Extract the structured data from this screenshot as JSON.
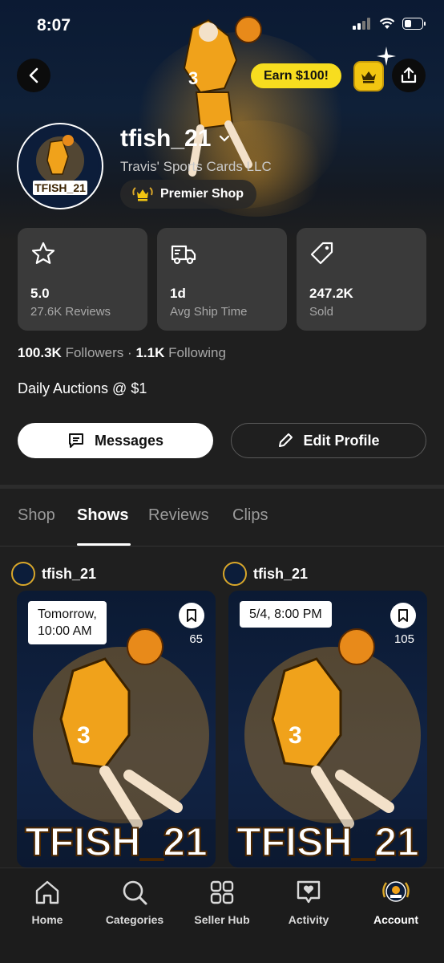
{
  "status_bar": {
    "time": "8:07"
  },
  "header": {
    "earn_label": "Earn $100!"
  },
  "profile": {
    "username": "tfish_21",
    "shop_name": "Travis' Sports Cards LLC",
    "badge_label": "Premier Shop",
    "avatar_text": "TFISH_21",
    "bio": "Daily Auctions @ $1"
  },
  "stats": [
    {
      "icon": "star-icon",
      "value": "5.0",
      "label": "27.6K Reviews"
    },
    {
      "icon": "truck-icon",
      "value": "1d",
      "label": "Avg Ship Time"
    },
    {
      "icon": "tag-icon",
      "value": "247.2K",
      "label": "Sold"
    }
  ],
  "follow": {
    "followers_count": "100.3K",
    "followers_label": "Followers",
    "separator": "·",
    "following_count": "1.1K",
    "following_label": "Following"
  },
  "actions": {
    "messages_label": "Messages",
    "edit_label": "Edit Profile"
  },
  "tabs": [
    {
      "label": "Shop",
      "active": false
    },
    {
      "label": "Shows",
      "active": true
    },
    {
      "label": "Reviews",
      "active": false
    },
    {
      "label": "Clips",
      "active": false
    }
  ],
  "shows": [
    {
      "host": "tfish_21",
      "time": "Tomorrow,\n10:00 AM",
      "time_line1": "Tomorrow,",
      "time_line2": "10:00 AM",
      "bookmarks": "65",
      "art_text": "TFISH_21"
    },
    {
      "host": "tfish_21",
      "time_line1": "5/4, 8:00 PM",
      "time_line2": "",
      "bookmarks": "105",
      "art_text": "TFISH_21"
    }
  ],
  "nav": [
    {
      "label": "Home",
      "icon": "home-icon"
    },
    {
      "label": "Categories",
      "icon": "search-icon"
    },
    {
      "label": "Seller Hub",
      "icon": "grid-icon"
    },
    {
      "label": "Activity",
      "icon": "heart-chat-icon"
    },
    {
      "label": "Account",
      "icon": "account-avatar-icon",
      "active": true
    }
  ],
  "colors": {
    "earn_yellow": "#f7dd1f",
    "crown_gold": "#f2c511",
    "player_orange": "#f0a21b",
    "navy": "#0c1d3a"
  }
}
